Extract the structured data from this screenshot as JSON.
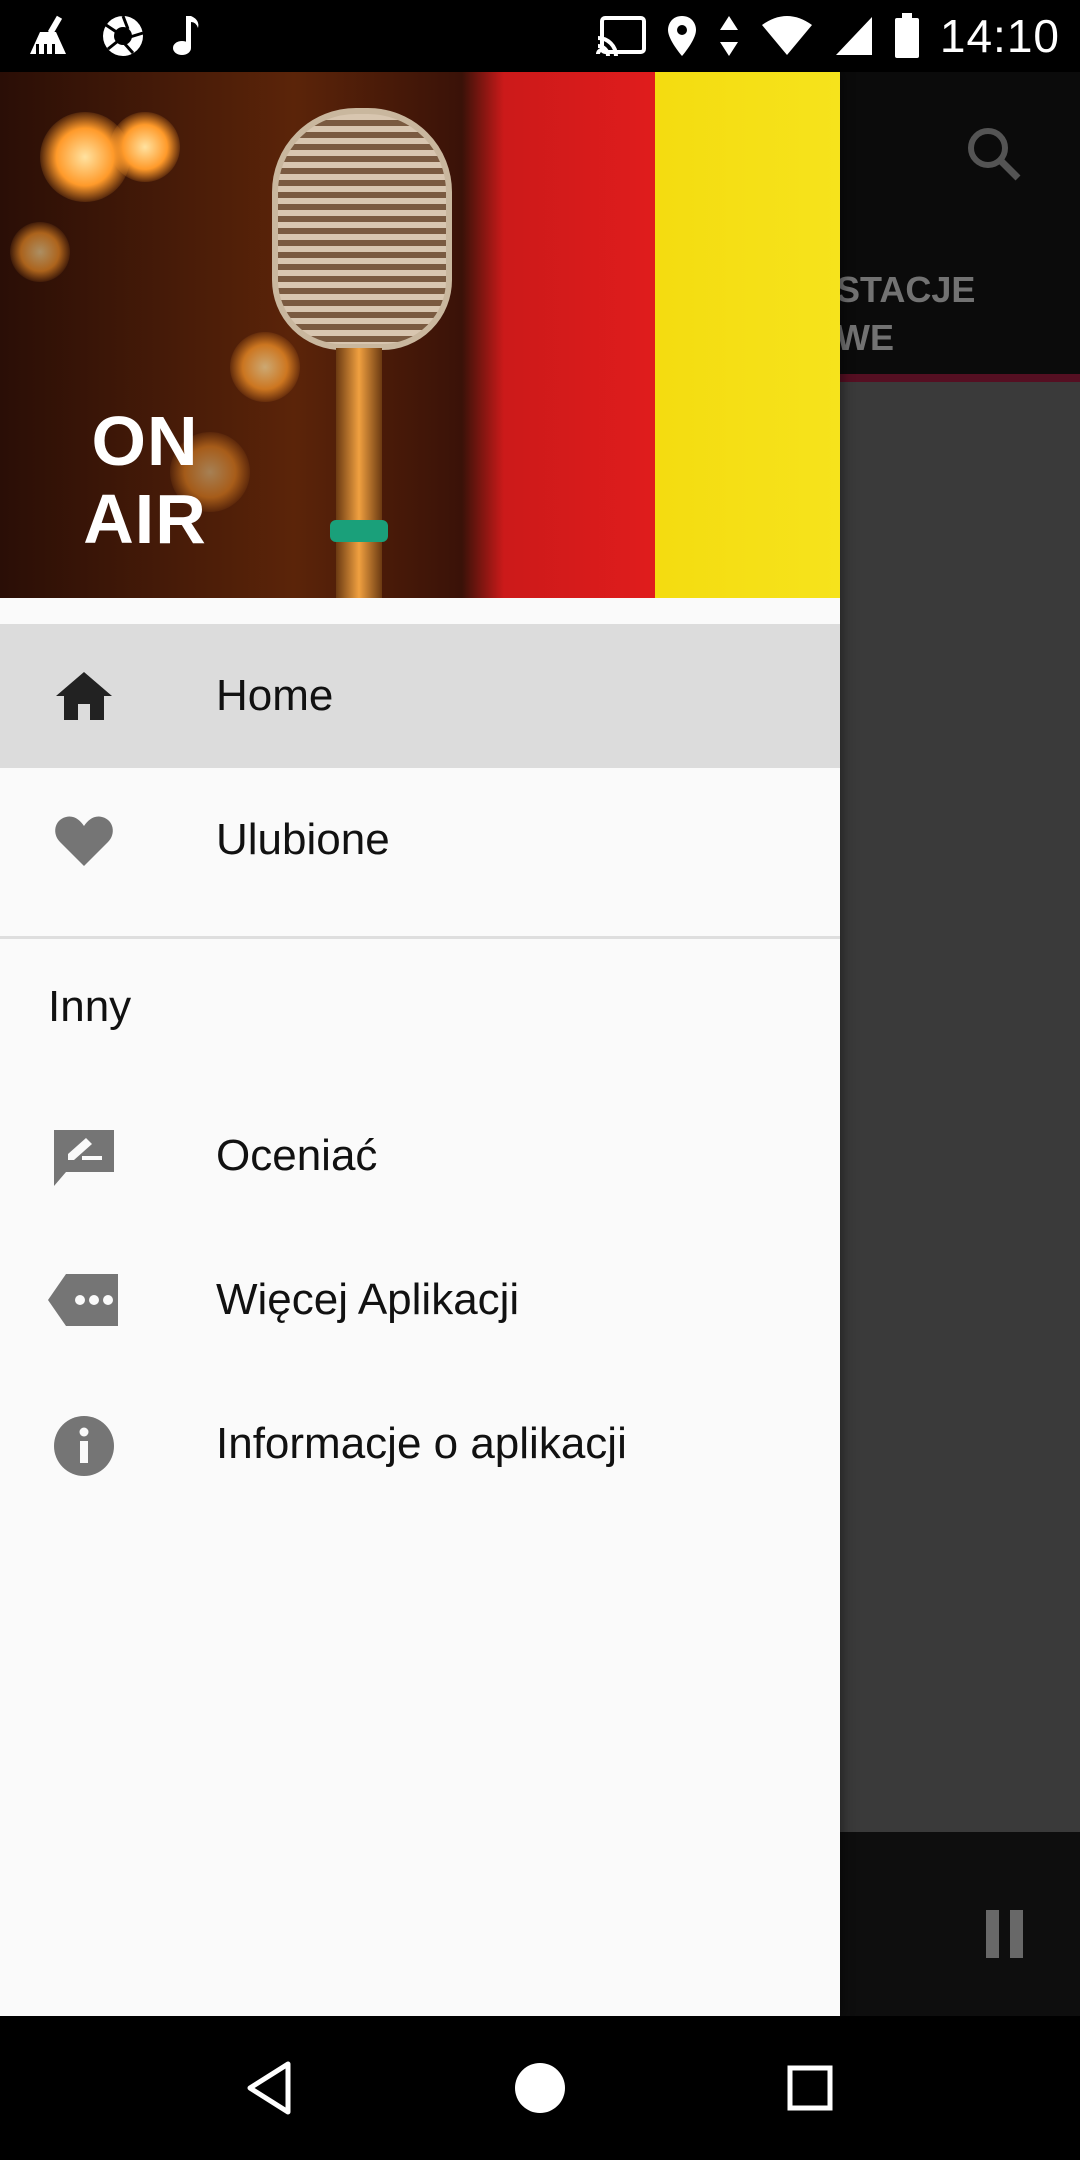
{
  "status_bar": {
    "time": "14:10",
    "left_icons": [
      "cleaner-icon",
      "camera-aperture-icon",
      "music-note-icon"
    ],
    "right_icons": [
      "cast-icon",
      "location-icon",
      "data-arrows-icon",
      "wifi-icon",
      "signal-icon",
      "battery-icon"
    ]
  },
  "background_app": {
    "tab_label": "STACJE\nWE",
    "accent_color": "#9b1d3e"
  },
  "drawer": {
    "header": {
      "badge_text": "ON AIR"
    },
    "items": [
      {
        "label": "Home",
        "icon": "home-icon",
        "selected": true
      },
      {
        "label": "Ulubione",
        "icon": "heart-icon",
        "selected": false
      }
    ],
    "section_title": "Inny",
    "other_items": [
      {
        "label": "Oceniać",
        "icon": "rate-review-icon"
      },
      {
        "label": "Więcej Aplikacji",
        "icon": "more-apps-icon"
      },
      {
        "label": "Informacje o aplikacji",
        "icon": "info-icon"
      }
    ]
  },
  "nav_bar": {
    "buttons": [
      "back-icon",
      "home-circle-icon",
      "recents-icon"
    ]
  }
}
